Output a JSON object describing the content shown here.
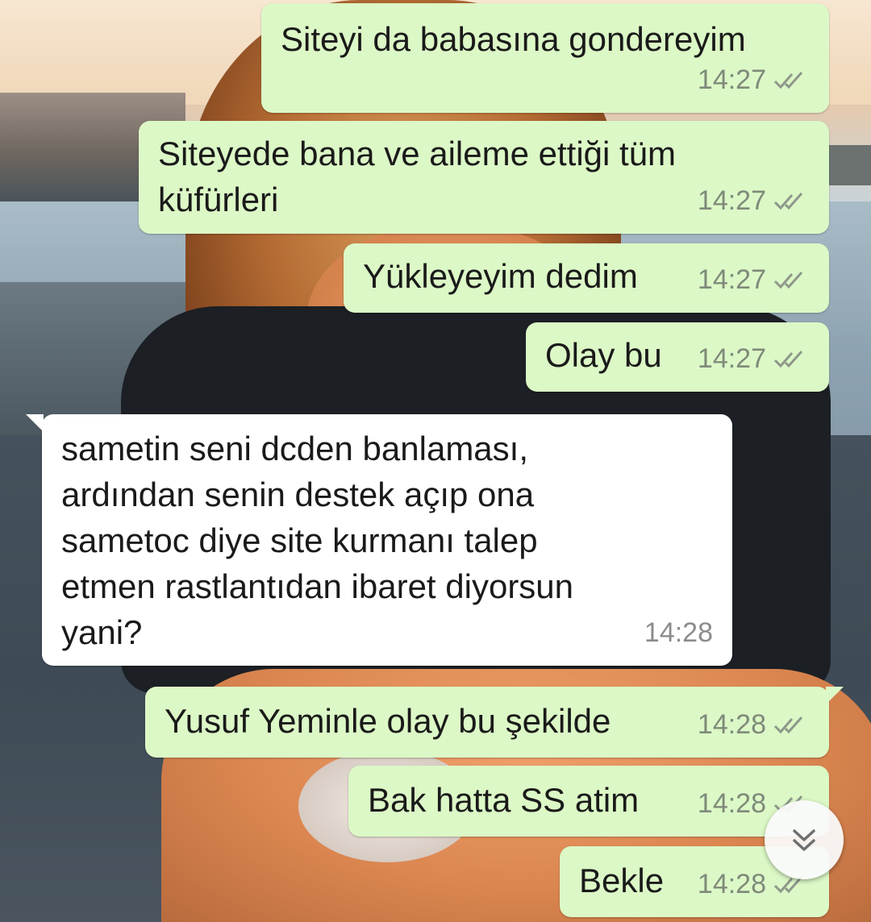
{
  "messages": [
    {
      "text": "Siteyi da babasına gondereyim",
      "time": "14:27",
      "direction": "outgoing",
      "status": "delivered"
    },
    {
      "text": "Siteyede bana ve aileme ettiği tüm\nküfürleri",
      "time": "14:27",
      "direction": "outgoing",
      "status": "delivered"
    },
    {
      "text": "Yükleyeyim dedim",
      "time": "14:27",
      "direction": "outgoing",
      "status": "delivered"
    },
    {
      "text": "Olay bu",
      "time": "14:27",
      "direction": "outgoing",
      "status": "delivered"
    },
    {
      "text": "sametin seni dcden banlaması,\nardından senin destek açıp ona\nsametoc diye site kurmanı talep\netmen rastlantıdan ibaret diyorsun\nyani?",
      "time": "14:28",
      "direction": "incoming"
    },
    {
      "text": "Yusuf Yeminle olay bu şekilde",
      "time": "14:28",
      "direction": "outgoing",
      "status": "delivered"
    },
    {
      "text": "Bak hatta SS atim",
      "time": "14:28",
      "direction": "outgoing",
      "status": "delivered"
    },
    {
      "text": "Bekle",
      "time": "14:28",
      "direction": "outgoing",
      "status": "delivered"
    }
  ],
  "icons": {
    "delivered": "double-check-icon",
    "scroll": "double-chevron-down-icon"
  },
  "colors": {
    "outgoing_bubble": "#dcf8c6",
    "incoming_bubble": "#ffffff",
    "timestamp": "#7f8a7a"
  }
}
